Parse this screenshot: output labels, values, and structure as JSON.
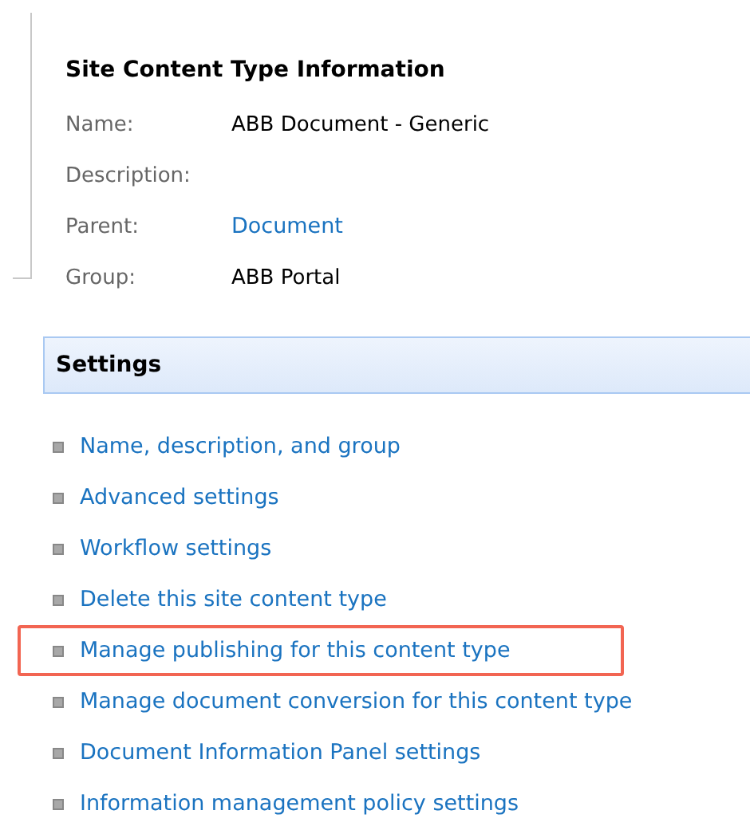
{
  "info": {
    "title": "Site Content Type Information",
    "fields": [
      {
        "label": "Name:",
        "value": "ABB Document - Generic",
        "kind": "text"
      },
      {
        "label": "Description:"
      },
      {
        "label": "Parent:",
        "value": "Document",
        "kind": "link"
      },
      {
        "label": "Group:",
        "value": "ABB Portal",
        "kind": "text"
      }
    ]
  },
  "settings": {
    "title": "Settings",
    "items": [
      {
        "label": "Name, description, and group",
        "highlighted": false
      },
      {
        "label": "Advanced settings",
        "highlighted": false
      },
      {
        "label": "Workflow settings",
        "highlighted": false
      },
      {
        "label": "Delete this site content type",
        "highlighted": false
      },
      {
        "label": "Manage publishing for this content type",
        "highlighted": true
      },
      {
        "label": "Manage document conversion for this content type",
        "highlighted": false
      },
      {
        "label": "Document Information Panel settings",
        "highlighted": false
      },
      {
        "label": "Information management policy settings",
        "highlighted": false
      }
    ]
  }
}
